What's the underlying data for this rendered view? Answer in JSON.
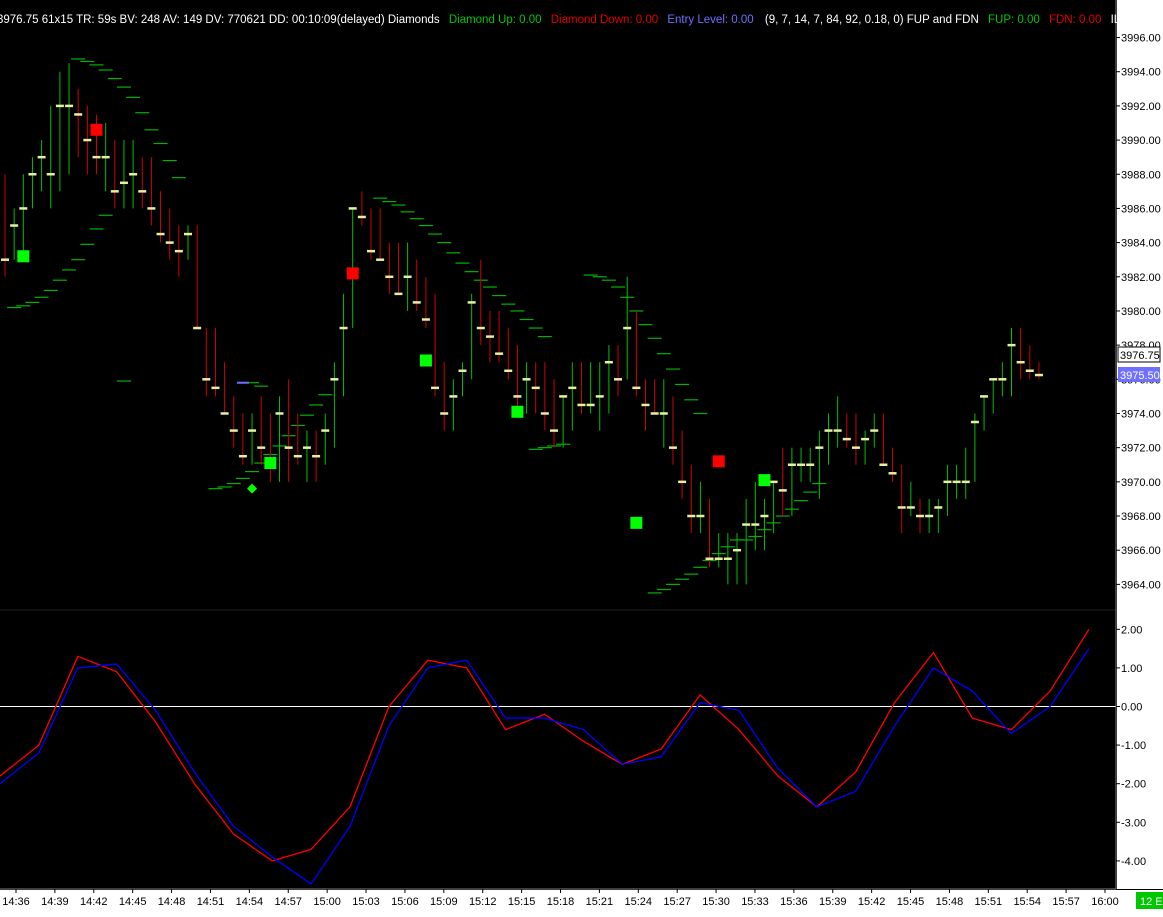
{
  "header": {
    "info": "3976.75  61x15  TR: 59s  BV: 248  AV: 149  DV: 770621  DD: 00:10:09(delayed)  Diamonds",
    "items": [
      {
        "text": "Diamond Up: 0.00",
        "color": "#00c800"
      },
      {
        "text": "Diamond Down: 0.00",
        "color": "#e00000"
      },
      {
        "text": "Entry Level: 0.00",
        "color": "#7070ff"
      },
      {
        "text": "(9, 7, 14, 7, 84, 92, 0.18, 0)  FUP and FDN",
        "color": "#ffffff"
      },
      {
        "text": "FUP: 0.00",
        "color": "#00c800"
      },
      {
        "text": "FDN: 0.00",
        "color": "#e00000"
      },
      {
        "text": "ILM Cross",
        "color": "#ffffff"
      }
    ]
  },
  "price_tag": "3976.75",
  "entry_tag": "3975.50",
  "corner_tag": "12 E",
  "colors": {
    "background": "#000000",
    "bar_up": "#00c000",
    "bar_down": "#d00000",
    "bar_tick": "#e6f0a0",
    "envelope": "#00b400",
    "diamond_up": "#00ff00",
    "diamond_down": "#ff0000",
    "osc_fast": "#ff0000",
    "osc_slow": "#0000ff",
    "zero_line": "#ffffff"
  },
  "chart_data": [
    {
      "type": "ohlc",
      "ylim": [
        3962.5,
        3996.5
      ],
      "yticks": [
        "3996.00",
        "3994.00",
        "3992.00",
        "3990.00",
        "3988.00",
        "3986.00",
        "3984.00",
        "3982.00",
        "3980.00",
        "3978.00",
        "3976.00",
        "3974.00",
        "3972.00",
        "3970.00",
        "3968.00",
        "3966.00",
        "3964.00"
      ],
      "bars": [
        [
          3988,
          3988,
          3982,
          3983
        ],
        [
          3984,
          3986,
          3983,
          3985
        ],
        [
          3985,
          3988,
          3983,
          3986
        ],
        [
          3986,
          3989,
          3986,
          3988
        ],
        [
          3988,
          3990,
          3987,
          3989
        ],
        [
          3988,
          3992,
          3986,
          3988
        ],
        [
          3988,
          3994,
          3987,
          3992
        ],
        [
          3992,
          3994.5,
          3988,
          3992
        ],
        [
          3992,
          3993,
          3989,
          3991.5
        ],
        [
          3991.5,
          3992,
          3988,
          3990
        ],
        [
          3990,
          3991.5,
          3988,
          3989
        ],
        [
          3989,
          3991,
          3987,
          3989
        ],
        [
          3989,
          3990,
          3986,
          3987
        ],
        [
          3987,
          3990,
          3986,
          3987.5
        ],
        [
          3987.5,
          3990,
          3986,
          3988
        ],
        [
          3988,
          3989,
          3986,
          3987
        ],
        [
          3987,
          3989,
          3985,
          3986
        ],
        [
          3986,
          3987,
          3984,
          3984.5
        ],
        [
          3984.5,
          3986,
          3983,
          3984
        ],
        [
          3984,
          3985,
          3982,
          3983.5
        ],
        [
          3983.5,
          3985,
          3983,
          3984.5
        ],
        [
          3984.5,
          3985,
          3979,
          3979
        ],
        [
          3979,
          3979,
          3975,
          3976
        ],
        [
          3976,
          3979,
          3975,
          3975.5
        ],
        [
          3975.5,
          3977,
          3974,
          3974
        ],
        [
          3974,
          3975,
          3972,
          3973
        ],
        [
          3973,
          3974,
          3971,
          3971.5
        ],
        [
          3971.5,
          3974,
          3971,
          3973
        ],
        [
          3973,
          3975,
          3971,
          3972
        ],
        [
          3972,
          3974,
          3970,
          3971
        ],
        [
          3971,
          3975,
          3970,
          3974
        ],
        [
          3974,
          3976,
          3970,
          3972
        ],
        [
          3972,
          3974,
          3971,
          3971.5
        ],
        [
          3971.5,
          3973,
          3970,
          3972
        ],
        [
          3972,
          3973,
          3970,
          3971.5
        ],
        [
          3971.5,
          3974,
          3971,
          3973
        ],
        [
          3973,
          3977,
          3972,
          3976
        ],
        [
          3976,
          3981,
          3975,
          3979
        ],
        [
          3979,
          3986,
          3979,
          3986
        ],
        [
          3986,
          3987,
          3985,
          3985.5
        ],
        [
          3985.5,
          3986,
          3983,
          3983.5
        ],
        [
          3983.5,
          3986,
          3983,
          3983
        ],
        [
          3983,
          3984,
          3981,
          3982
        ],
        [
          3982,
          3984,
          3981,
          3981
        ],
        [
          3981,
          3984,
          3980,
          3982
        ],
        [
          3982,
          3983,
          3980,
          3980.5
        ],
        [
          3980.5,
          3982,
          3979,
          3979.5
        ],
        [
          3979.5,
          3981,
          3975,
          3975.5
        ],
        [
          3975.5,
          3977,
          3973,
          3974
        ],
        [
          3974,
          3976,
          3973,
          3975
        ],
        [
          3975,
          3977,
          3975,
          3976.5
        ],
        [
          3976.5,
          3981,
          3976,
          3980.5
        ],
        [
          3980.5,
          3983,
          3978,
          3979
        ],
        [
          3979,
          3980,
          3977,
          3978.5
        ],
        [
          3978.5,
          3980,
          3977,
          3977.5
        ],
        [
          3977.5,
          3979,
          3976,
          3976.5
        ],
        [
          3976.5,
          3978,
          3974,
          3975
        ],
        [
          3975,
          3977,
          3974,
          3976
        ],
        [
          3976,
          3977,
          3974,
          3975.5
        ],
        [
          3975.5,
          3977,
          3973,
          3974
        ],
        [
          3974,
          3976,
          3972,
          3973
        ],
        [
          3973,
          3975,
          3972,
          3975
        ],
        [
          3975,
          3977,
          3973,
          3975.5
        ],
        [
          3975.5,
          3977,
          3974,
          3974.5
        ],
        [
          3974.5,
          3977,
          3974,
          3974.5
        ],
        [
          3974.5,
          3977,
          3973,
          3975
        ],
        [
          3975,
          3978,
          3974,
          3977
        ],
        [
          3977,
          3978,
          3975,
          3976
        ],
        [
          3976,
          3982,
          3976,
          3979
        ],
        [
          3979,
          3980,
          3975,
          3975.5
        ],
        [
          3975.5,
          3976,
          3973,
          3974.5
        ],
        [
          3974.5,
          3976,
          3974,
          3974
        ],
        [
          3974,
          3976,
          3972,
          3974
        ],
        [
          3974,
          3975,
          3971,
          3972
        ],
        [
          3972,
          3973,
          3969,
          3970
        ],
        [
          3970,
          3971,
          3967,
          3968
        ],
        [
          3968,
          3970,
          3967,
          3968
        ],
        [
          3968,
          3969,
          3965,
          3965.5
        ],
        [
          3965.5,
          3967,
          3965,
          3965.5
        ],
        [
          3965.5,
          3967,
          3964,
          3965.5
        ],
        [
          3965.5,
          3967,
          3964,
          3966
        ],
        [
          3966,
          3969,
          3964,
          3967.5
        ],
        [
          3967.5,
          3970,
          3966,
          3967.5
        ],
        [
          3967.5,
          3969,
          3966,
          3968
        ],
        [
          3968,
          3970,
          3967,
          3970
        ],
        [
          3970,
          3972,
          3968,
          3969.5
        ],
        [
          3969.5,
          3972,
          3968,
          3971
        ],
        [
          3971,
          3972,
          3970,
          3971
        ],
        [
          3971,
          3972,
          3970,
          3971
        ],
        [
          3971,
          3973,
          3969,
          3972
        ],
        [
          3972,
          3974,
          3971,
          3973
        ],
        [
          3973,
          3975,
          3972,
          3973
        ],
        [
          3973,
          3974,
          3972,
          3972.5
        ],
        [
          3972.5,
          3974,
          3971,
          3972
        ],
        [
          3972,
          3973,
          3971,
          3972.5
        ],
        [
          3972.5,
          3974,
          3972,
          3973
        ],
        [
          3973,
          3974,
          3971,
          3971
        ],
        [
          3971,
          3972,
          3970,
          3970.5
        ],
        [
          3970.5,
          3971,
          3967,
          3968.5
        ],
        [
          3968.5,
          3970,
          3968,
          3968.5
        ],
        [
          3968.5,
          3969,
          3967,
          3968
        ],
        [
          3968,
          3969,
          3967,
          3968
        ],
        [
          3968,
          3969,
          3967,
          3968.5
        ],
        [
          3968.5,
          3971,
          3968,
          3970
        ],
        [
          3970,
          3971,
          3969,
          3970
        ],
        [
          3970,
          3972,
          3969,
          3970
        ],
        [
          3970,
          3974,
          3970,
          3973.5
        ],
        [
          3973.5,
          3975,
          3973,
          3975
        ],
        [
          3975,
          3976,
          3974,
          3976
        ],
        [
          3976,
          3977,
          3975,
          3976
        ],
        [
          3976,
          3979,
          3975,
          3978
        ],
        [
          3978,
          3979,
          3976,
          3977
        ],
        [
          3977,
          3978,
          3976,
          3976.5
        ],
        [
          3976.5,
          3977,
          3976,
          3976.25
        ]
      ],
      "envelope_upper": [
        {
          "x": 8,
          "y": [
            3994.75,
            3994.6,
            3994.4,
            3994.1,
            3993.6,
            3993.1,
            3992.5,
            3991.6,
            3990.6,
            3989.8,
            3988.8,
            3987.8
          ]
        },
        {
          "x": 27,
          "y": [
            3975.8,
            3975.6
          ]
        },
        {
          "x": 41,
          "y": [
            3986.6,
            3986.4,
            3986.2,
            3985.8,
            3985.4,
            3985.0,
            3984.5,
            3984.0,
            3983.4,
            3982.8,
            3982.3,
            3981.8,
            3981.4,
            3980.9,
            3980.4,
            3980.0,
            3979.5,
            3979.0,
            3978.5
          ]
        },
        {
          "x": 64,
          "y": [
            3982.1,
            3982.0,
            3981.8,
            3981.4,
            3980.8,
            3980.0,
            3979.2,
            3978.4,
            3977.5,
            3976.6,
            3975.7,
            3974.8,
            3974.0
          ]
        }
      ],
      "envelope_lower": [
        {
          "x": 1,
          "y": [
            3980.2,
            3980.3,
            3980.5,
            3980.8,
            3981.2,
            3981.8,
            3982.4,
            3983.0,
            3983.9,
            3984.8,
            3985.6
          ]
        },
        {
          "x": 13,
          "y": [
            3975.9
          ]
        },
        {
          "x": 23,
          "y": [
            3969.6,
            3969.7,
            3969.9,
            3970.2,
            3970.6,
            3971.1,
            3971.6,
            3972.1,
            3972.7,
            3973.3,
            3973.9,
            3974.5,
            3975.1
          ]
        },
        {
          "x": 58,
          "y": [
            3971.9,
            3972.0,
            3972.1,
            3972.2
          ]
        },
        {
          "x": 71,
          "y": [
            3963.5,
            3963.7,
            3964.0,
            3964.3,
            3964.6,
            3965.0,
            3965.4,
            3965.8,
            3966.2,
            3966.6,
            3966.6,
            3966.8,
            3967.2,
            3967.6,
            3968.0,
            3968.4,
            3968.9,
            3969.4,
            3969.9
          ]
        }
      ],
      "diamonds_up": [
        [
          2,
          3983.2
        ],
        [
          29,
          3971.1
        ],
        [
          46,
          3977.1
        ],
        [
          56,
          3974.1
        ],
        [
          69,
          3967.6
        ],
        [
          83,
          3970.1
        ]
      ],
      "diamonds_down": [
        [
          10,
          3990.6
        ],
        [
          38,
          3982.2
        ],
        [
          78,
          3971.2
        ]
      ],
      "entry_marker": [
        27,
        3969.6
      ],
      "entry_tick": [
        26,
        3975.8
      ]
    },
    {
      "type": "line",
      "ylim": [
        -4.65,
        2.5
      ],
      "yticks": [
        "2.00",
        "1.00",
        "0.00",
        "-1.00",
        "-2.00",
        "-3.00",
        "-4.00"
      ],
      "x": [
        "14:36",
        "14:39",
        "14:42",
        "14:45",
        "14:48",
        "14:51",
        "14:54",
        "14:57",
        "15:00",
        "15:03",
        "15:06",
        "15:09",
        "15:12",
        "15:15",
        "15:18",
        "15:21",
        "15:24",
        "15:27",
        "15:30",
        "15:33",
        "15:36",
        "15:39",
        "15:42",
        "15:45",
        "15:48",
        "15:51",
        "15:54",
        "15:57",
        "16:00"
      ],
      "series": [
        {
          "color": "#ff0000",
          "values": [
            -1.8,
            -1.0,
            1.3,
            0.9,
            -0.4,
            -2.0,
            -3.3,
            -4.0,
            -3.7,
            -2.6,
            0.0,
            1.2,
            1.0,
            -0.6,
            -0.2,
            -0.9,
            -1.5,
            -1.1,
            0.3,
            -0.6,
            -1.8,
            -2.6,
            -1.7,
            0.1,
            1.4,
            -0.3,
            -0.6,
            0.4,
            2.0
          ]
        },
        {
          "color": "#0000ff",
          "values": [
            -2.0,
            -1.2,
            1.0,
            1.1,
            -0.1,
            -1.7,
            -3.1,
            -3.9,
            -4.6,
            -3.1,
            -0.5,
            1.0,
            1.2,
            -0.3,
            -0.3,
            -0.6,
            -1.5,
            -1.3,
            0.1,
            -0.1,
            -1.6,
            -2.6,
            -2.2,
            -0.5,
            1.0,
            0.4,
            -0.7,
            0.0,
            1.5
          ]
        }
      ],
      "zero_line": 0
    }
  ]
}
